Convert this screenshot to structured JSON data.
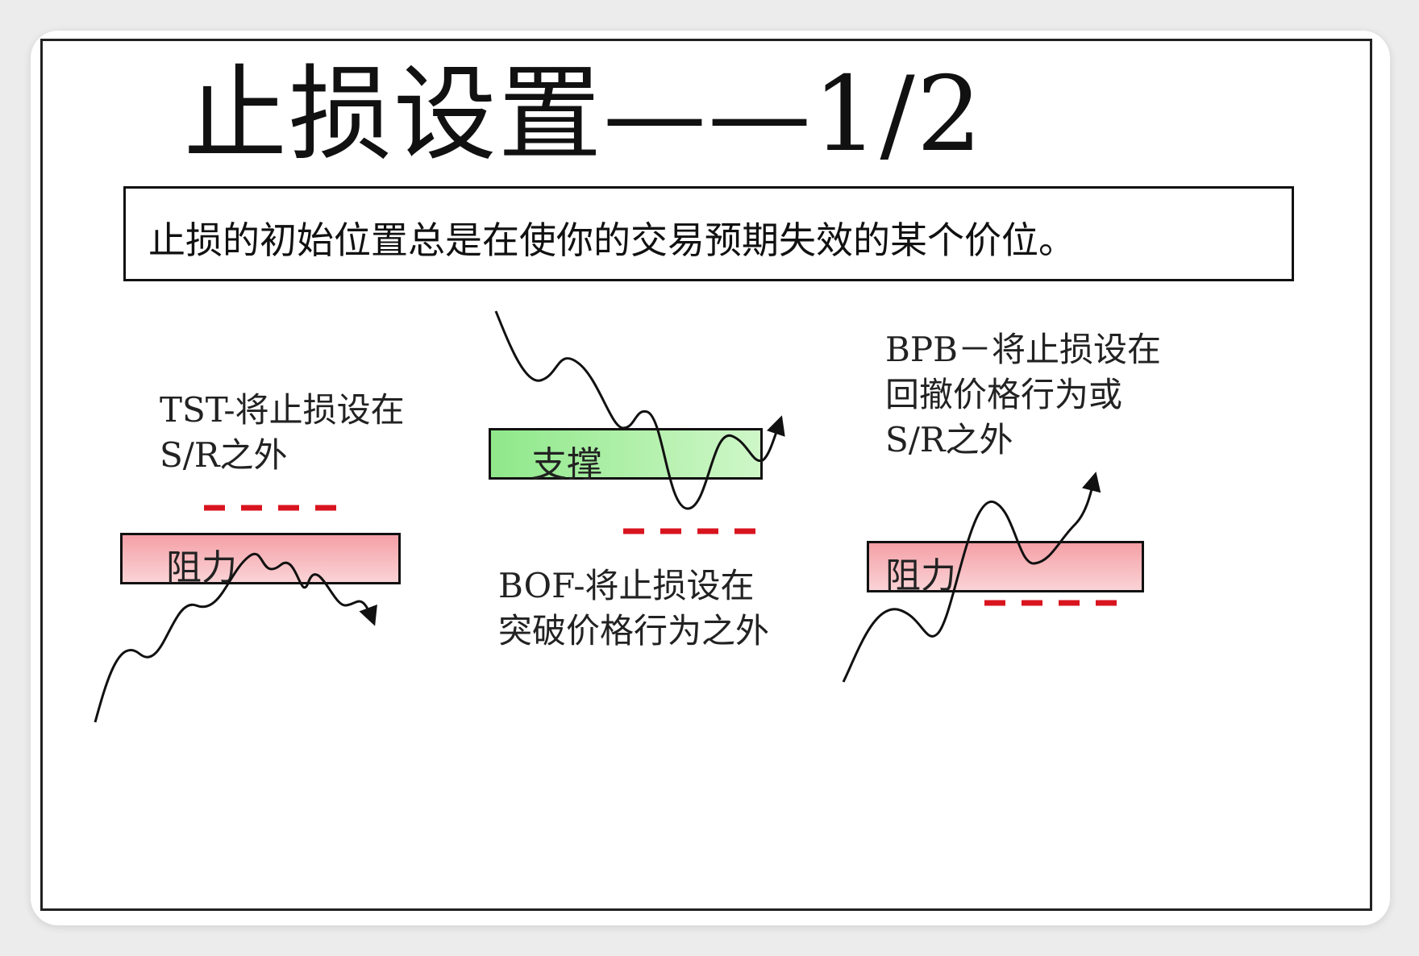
{
  "title": "止损设置——1/2",
  "subtitle": "止损的初始位置总是在使你的交易预期失效的某个价位。",
  "panels": {
    "tst": {
      "note_line1": "TST-将止损设在",
      "note_line2": "S/R之外",
      "zone_label": "阻力"
    },
    "bof": {
      "zone_label": "支撑",
      "note_line1": "BOF-将止损设在",
      "note_line2": "突破价格行为之外"
    },
    "bpb": {
      "note_line1": "BPB－将止损设在",
      "note_line2": "回撤价格行为或",
      "note_line3": "S/R之外",
      "zone_label": "阻力"
    }
  },
  "colors": {
    "stop_line": "#d8141f",
    "resistance_fill": "#f4a0a6",
    "support_fill": "#8fe88a",
    "price_line": "#111111"
  }
}
